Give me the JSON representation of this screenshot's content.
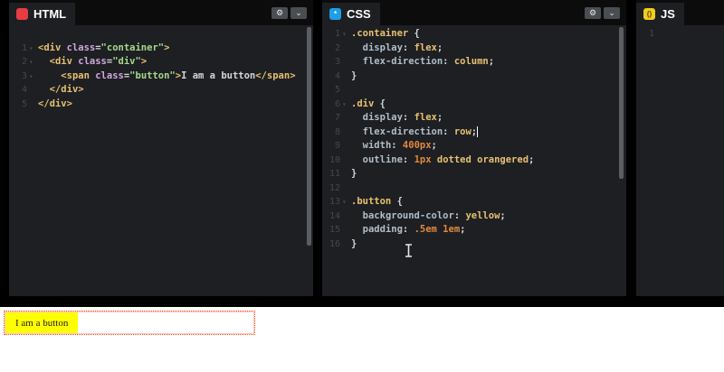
{
  "colors": {
    "html_icon": "#e63c43",
    "css_icon": "#1d9fe8",
    "js_icon": "#f2cb22",
    "editor_bg": "#1d1f23",
    "preview_button_bg": "#ffff00",
    "preview_outline": "orangered"
  },
  "panes": {
    "html": {
      "title": "HTML",
      "icon": "html-file-icon",
      "lines": [
        {
          "n": "1",
          "fold": "▾"
        },
        {
          "n": "2",
          "fold": "▾"
        },
        {
          "n": "3",
          "fold": "▾"
        },
        {
          "n": "4",
          "fold": ""
        },
        {
          "n": "5",
          "fold": ""
        }
      ]
    },
    "css": {
      "title": "CSS",
      "icon": "css-file-icon",
      "lines": [
        {
          "n": "1",
          "fold": "▾"
        },
        {
          "n": "2",
          "fold": ""
        },
        {
          "n": "3",
          "fold": ""
        },
        {
          "n": "4",
          "fold": ""
        },
        {
          "n": "5",
          "fold": ""
        },
        {
          "n": "6",
          "fold": "▾"
        },
        {
          "n": "7",
          "fold": ""
        },
        {
          "n": "8",
          "fold": ""
        },
        {
          "n": "9",
          "fold": ""
        },
        {
          "n": "10",
          "fold": ""
        },
        {
          "n": "11",
          "fold": ""
        },
        {
          "n": "12",
          "fold": ""
        },
        {
          "n": "13",
          "fold": "▾"
        },
        {
          "n": "14",
          "fold": ""
        },
        {
          "n": "15",
          "fold": ""
        },
        {
          "n": "16",
          "fold": ""
        }
      ]
    },
    "js": {
      "title": "JS",
      "icon": "js-file-icon",
      "lines": [
        {
          "n": "1",
          "fold": ""
        }
      ]
    }
  },
  "html_code": {
    "l1": {
      "open": "<div ",
      "attr": "class",
      "eq": "=",
      "str": "\"container\"",
      "close": ">"
    },
    "l2": {
      "open": "<div ",
      "attr": "class",
      "eq": "=",
      "str": "\"div\"",
      "close": ">"
    },
    "l3": {
      "open": "<span ",
      "attr": "class",
      "eq": "=",
      "str": "\"button\"",
      "close": ">",
      "text": "I am a button",
      "end": "</span>"
    },
    "l4": {
      "end": "</div>"
    },
    "l5": {
      "end": "</div>"
    }
  },
  "css_code": {
    "l1": {
      "sel": ".container",
      "brace": " {"
    },
    "l2": {
      "prop": "display",
      "colon": ": ",
      "val": "flex",
      "semi": ";"
    },
    "l3": {
      "prop": "flex-direction",
      "colon": ": ",
      "val": "column",
      "semi": ";"
    },
    "l4": {
      "brace": "}"
    },
    "l6": {
      "sel": ".div",
      "brace": " {"
    },
    "l7": {
      "prop": "display",
      "colon": ": ",
      "val": "flex",
      "semi": ";"
    },
    "l8": {
      "prop": "flex-direction",
      "colon": ": ",
      "val": "row",
      "semi": ";"
    },
    "l9": {
      "prop": "width",
      "colon": ": ",
      "num": "400px",
      "semi": ";"
    },
    "l10": {
      "prop": "outline",
      "colon": ": ",
      "num": "1px",
      "val": " dotted orangered",
      "semi": ";"
    },
    "l11": {
      "brace": "}"
    },
    "l13": {
      "sel": ".button",
      "brace": " {"
    },
    "l14": {
      "prop": "background-color",
      "colon": ": ",
      "val": "yellow",
      "semi": ";"
    },
    "l15": {
      "prop": "padding",
      "colon": ": ",
      "num": ".5em 1em",
      "semi": ";"
    },
    "l16": {
      "brace": "}"
    }
  },
  "preview": {
    "button_text": "I am a button"
  }
}
